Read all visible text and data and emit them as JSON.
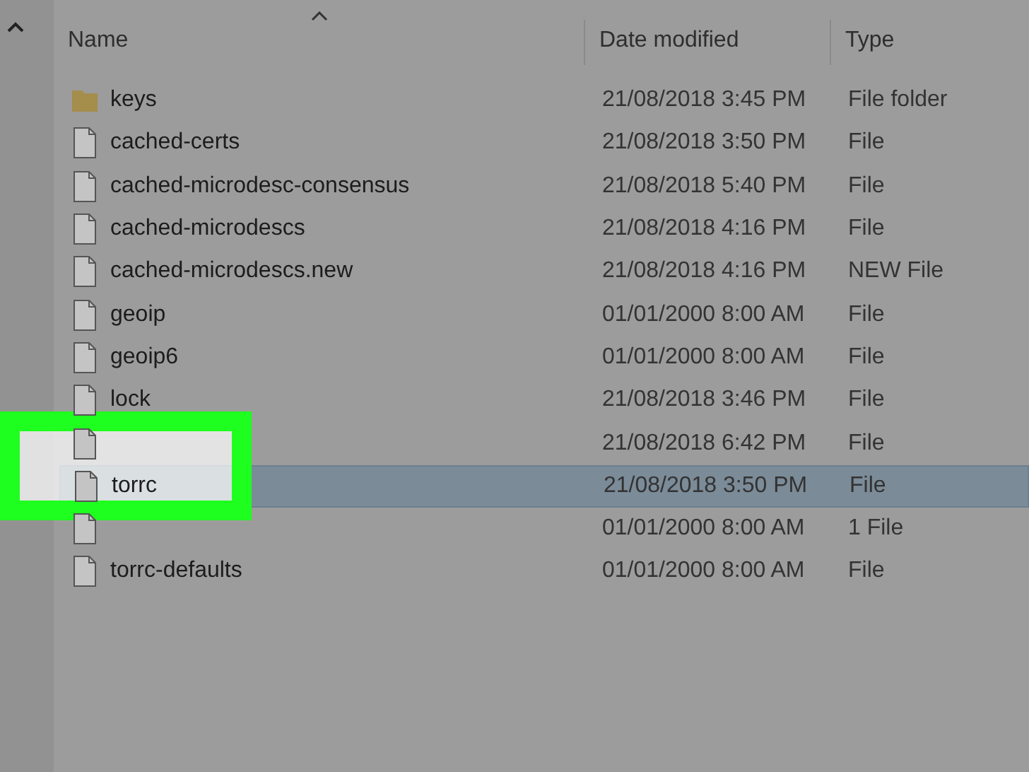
{
  "columns": [
    {
      "label": "Name",
      "sorted": true
    },
    {
      "label": "Date modified",
      "sorted": false
    },
    {
      "label": "Type",
      "sorted": false
    }
  ],
  "files": [
    {
      "kind": "folder",
      "name": "keys",
      "date": "21/08/2018 3:45 PM",
      "type": "File folder",
      "selected": false
    },
    {
      "kind": "file",
      "name": "cached-certs",
      "date": "21/08/2018 3:50 PM",
      "type": "File",
      "selected": false
    },
    {
      "kind": "file",
      "name": "cached-microdesc-consensus",
      "date": "21/08/2018 5:40 PM",
      "type": "File",
      "selected": false
    },
    {
      "kind": "file",
      "name": "cached-microdescs",
      "date": "21/08/2018 4:16 PM",
      "type": "File",
      "selected": false
    },
    {
      "kind": "file",
      "name": "cached-microdescs.new",
      "date": "21/08/2018 4:16 PM",
      "type": "NEW File",
      "selected": false
    },
    {
      "kind": "file",
      "name": "geoip",
      "date": "01/01/2000 8:00 AM",
      "type": "File",
      "selected": false
    },
    {
      "kind": "file",
      "name": "geoip6",
      "date": "01/01/2000 8:00 AM",
      "type": "File",
      "selected": false
    },
    {
      "kind": "file",
      "name": "lock",
      "date": "21/08/2018 3:46 PM",
      "type": "File",
      "selected": false
    },
    {
      "kind": "file",
      "date": "21/08/2018 6:42 PM",
      "type": "File",
      "selected": false
    },
    {
      "kind": "file",
      "name": "torrc",
      "date": "21/08/2018 3:50 PM",
      "type": "File",
      "selected": true
    },
    {
      "kind": "file",
      "date": "01/01/2000 8:00 AM",
      "type": "1 File",
      "selected": false
    },
    {
      "kind": "file",
      "name": "torrc-defaults",
      "date": "01/01/2000 8:00 AM",
      "type": "File",
      "selected": false
    }
  ]
}
